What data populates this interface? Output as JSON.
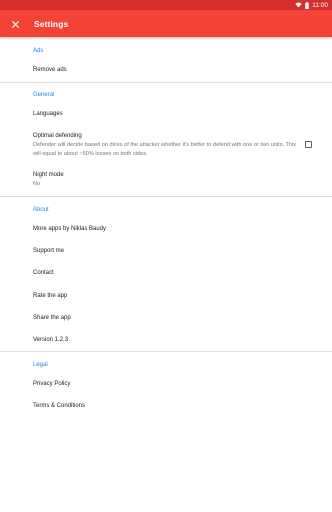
{
  "status_bar": {
    "time": "11:00",
    "wifi_icon": "wifi-icon",
    "battery_icon": "battery-icon",
    "background_color": "#d32f2f"
  },
  "toolbar": {
    "title": "Settings",
    "close_icon": "close-icon",
    "background_color": "#f44336"
  },
  "sections": {
    "ads": {
      "header": "Ads",
      "items": {
        "remove_ads": "Remove ads"
      }
    },
    "general": {
      "header": "General",
      "items": {
        "languages": "Languages",
        "optimal_defending_title": "Optimal defending",
        "optimal_defending_summary": "Defender will decide based on dices of the attacker whether it's better to defend with one or two units. This will equal to about ~50% losses on both sides.",
        "optimal_defending_checked": false,
        "night_mode_title": "Night mode",
        "night_mode_value": "No"
      }
    },
    "about": {
      "header": "About",
      "items": {
        "more_apps": "More apps by Niklas Baudy",
        "support_me": "Support me",
        "contact": "Contact",
        "rate_app": "Rate the app",
        "share_app": "Share the app",
        "version": "Version 1.2.3"
      }
    },
    "legal": {
      "header": "Legal",
      "items": {
        "privacy_policy": "Privacy Policy",
        "terms": "Terms & Conditions"
      }
    }
  },
  "colors": {
    "accent": "#1e88e5",
    "primary": "#f44336",
    "primary_dark": "#d32f2f"
  }
}
